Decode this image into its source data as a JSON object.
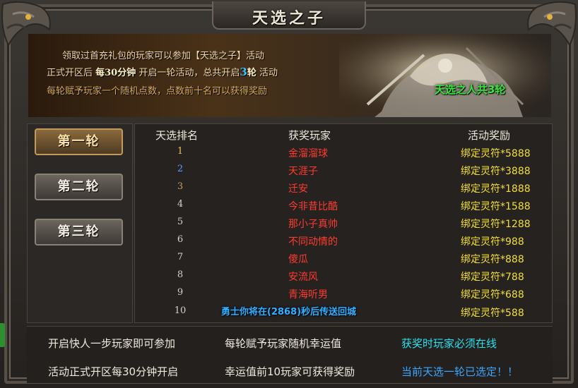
{
  "window": {
    "title": "天选之子"
  },
  "intro": {
    "line1": "领取过首充礼包的玩家可以参加【天选之子】活动",
    "line2_a": "正式开区后 ",
    "line2_b": "每30分钟",
    "line2_c": " 开启一轮活动，总共开启",
    "line2_num": "3",
    "line2_d": "轮",
    "line2_e": " 活动",
    "line3": "每轮赋予玩家一个随机点数，点数前十名可以获得奖励"
  },
  "round_total": "天选之人共3轮",
  "rounds": [
    {
      "label": "第一轮",
      "active": true
    },
    {
      "label": "第二轮",
      "active": false
    },
    {
      "label": "第三轮",
      "active": false
    }
  ],
  "table": {
    "headers": {
      "rank": "天选排名",
      "player": "获奖玩家",
      "reward": "活动奖励"
    },
    "rows": [
      {
        "rank": "1",
        "player": "金溜溜球",
        "reward": "绑定灵符*5888"
      },
      {
        "rank": "2",
        "player": "天涯子",
        "reward": "绑定灵符*3888"
      },
      {
        "rank": "3",
        "player": "迁安",
        "reward": "绑定灵符*1888"
      },
      {
        "rank": "4",
        "player": "今非昔比酷",
        "reward": "绑定灵符*1588"
      },
      {
        "rank": "5",
        "player": "那小子真帅",
        "reward": "绑定灵符*1288"
      },
      {
        "rank": "6",
        "player": "不同动情的",
        "reward": "绑定灵符*988"
      },
      {
        "rank": "7",
        "player": "傻瓜",
        "reward": "绑定灵符*888"
      },
      {
        "rank": "8",
        "player": "安流风",
        "reward": "绑定灵符*788"
      },
      {
        "rank": "9",
        "player": "青海听男",
        "reward": "绑定灵符*688"
      },
      {
        "rank": "10",
        "player": "",
        "reward": "绑定灵符*588"
      }
    ]
  },
  "notice": "勇士你将在(2868)秒后传送回城",
  "bottom": {
    "col1_a": "开启快人一步玩家即可参加",
    "col1_b": "活动正式开区每30分钟开启",
    "col2_a": "每轮赋予玩家随机幸运值",
    "col2_b": "幸运值前10玩家可获得奖励",
    "col3_a": "获奖时玩家必须在线",
    "col3_b": "当前天选一轮已选定！！"
  },
  "colors": {
    "accent_red": "#ff3b31",
    "reward_yellow": "#f2de36",
    "green": "#35e83b",
    "cyan": "#29e0f0"
  }
}
